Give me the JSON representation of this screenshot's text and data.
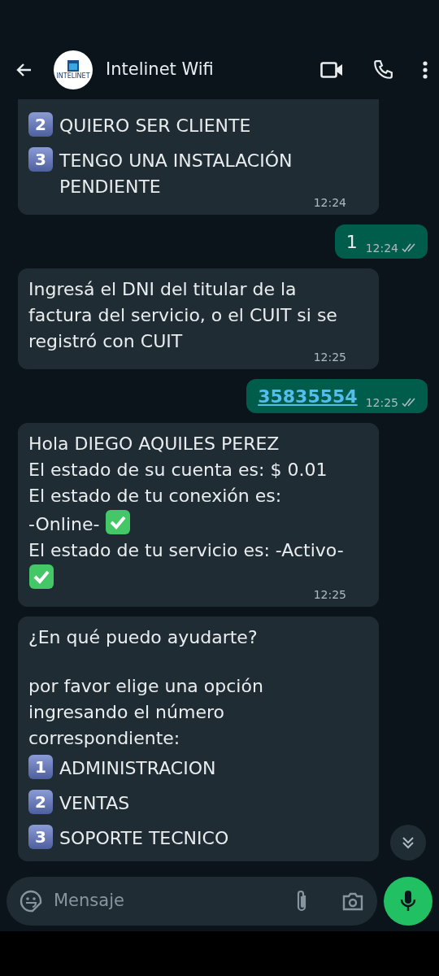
{
  "header": {
    "title": "Intelinet Wifi",
    "logo_text": "INTELINET"
  },
  "messages": [
    {
      "kind": "incoming",
      "time": "12:24",
      "blocks": [
        {
          "kind": "option",
          "number": "2",
          "text": "QUIERO SER CLIENTE"
        },
        {
          "kind": "option",
          "number": "3",
          "text": "TENGO UNA INSTALACIÓN PENDIENTE"
        }
      ]
    },
    {
      "kind": "outgoing",
      "time": "12:24",
      "read": false,
      "blocks": [
        {
          "kind": "text",
          "text": "1"
        }
      ]
    },
    {
      "kind": "incoming",
      "time": "12:25",
      "blocks": [
        {
          "kind": "text",
          "text": "Ingresá el DNI del titular de la factura del servicio, o el CUIT si se registró con CUIT"
        }
      ]
    },
    {
      "kind": "outgoing",
      "time": "12:25",
      "read": false,
      "blocks": [
        {
          "kind": "link",
          "text": "35835554"
        }
      ]
    },
    {
      "kind": "incoming",
      "time": "12:25",
      "blocks": [
        {
          "kind": "text",
          "text": "Hola DIEGO AQUILES PEREZ"
        },
        {
          "kind": "text",
          "text": "El estado de su cuenta es: $ 0.01"
        },
        {
          "kind": "text",
          "text": "El estado de tu conexión es:"
        },
        {
          "kind": "text_check",
          "text": "-Online-"
        },
        {
          "kind": "text",
          "text": "El estado de tu servicio es: -Activo-"
        },
        {
          "kind": "check"
        }
      ]
    },
    {
      "kind": "incoming",
      "blocks": [
        {
          "kind": "text",
          "text": "¿En qué puedo ayudarte?"
        },
        {
          "kind": "gap"
        },
        {
          "kind": "text",
          "text": "por favor elige una opción ingresando el número correspondiente:"
        },
        {
          "kind": "option",
          "number": "1",
          "text": "ADMINISTRACION"
        },
        {
          "kind": "option",
          "number": "2",
          "text": "VENTAS"
        },
        {
          "kind": "option",
          "number": "3",
          "text": "SOPORTE TECNICO"
        }
      ]
    }
  ],
  "composer": {
    "placeholder": "Mensaje"
  }
}
